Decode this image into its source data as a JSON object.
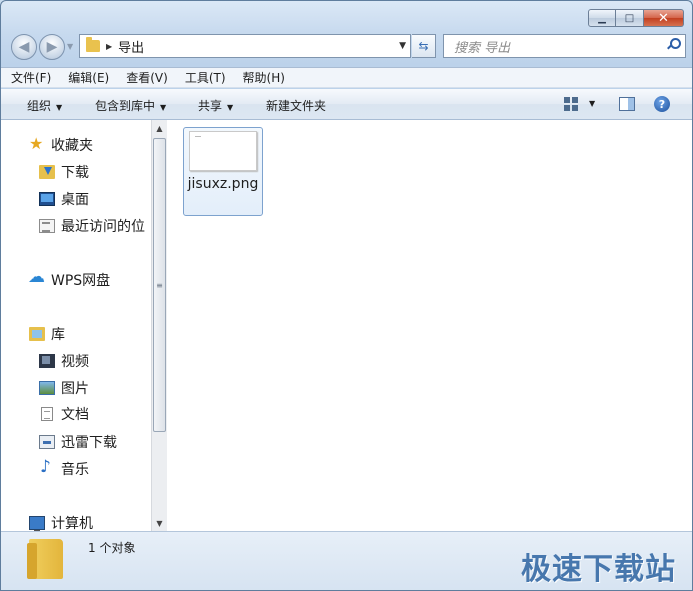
{
  "titlebar": {
    "minimize_icon": "minimize-icon",
    "maximize_icon": "maximize-icon",
    "close_icon": "close-icon"
  },
  "address": {
    "path": "导出"
  },
  "search": {
    "placeholder": "搜索 导出"
  },
  "menu": [
    "文件(F)",
    "编辑(E)",
    "查看(V)",
    "工具(T)",
    "帮助(H)"
  ],
  "commands": {
    "organize": "组织",
    "include_library": "包含到库中",
    "share": "共享",
    "new_folder": "新建文件夹"
  },
  "sidebar": {
    "favorites": "收藏夹",
    "downloads": "下载",
    "desktop": "桌面",
    "recent": "最近访问的位",
    "wps": "WPS网盘",
    "library": "库",
    "videos": "视频",
    "pictures": "图片",
    "documents": "文档",
    "xunlei": "迅雷下载",
    "music": "音乐",
    "computer": "计算机"
  },
  "files": [
    {
      "name": "jisuxz.png"
    }
  ],
  "status": {
    "count": "1 个对象",
    "watermark": "极速下载站"
  }
}
